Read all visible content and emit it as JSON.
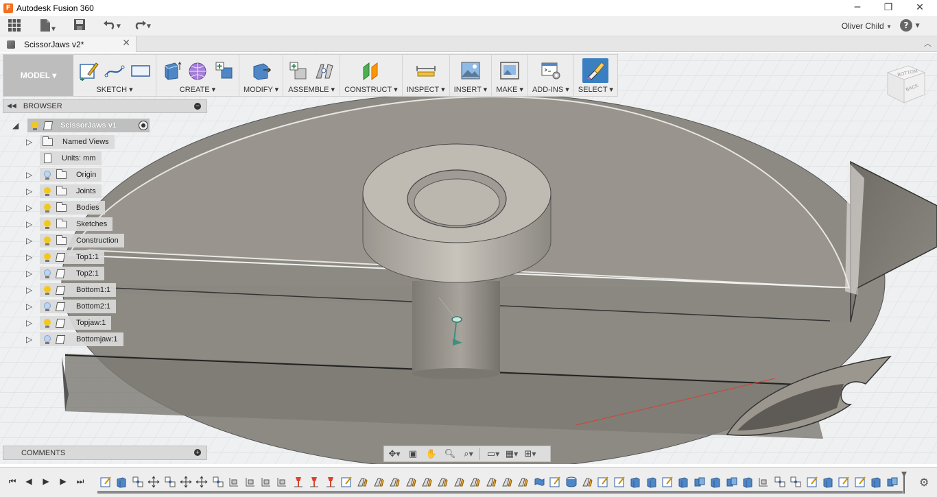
{
  "window": {
    "title": "Autodesk Fusion 360",
    "logo_letter": "F",
    "minimize_glyph": "─",
    "restore_glyph": "❐",
    "close_glyph": "✕"
  },
  "qat": {
    "user_name": "Oliver Child",
    "help_glyph": "?",
    "grid_icon": "app-grid-icon",
    "file_icon": "file-icon",
    "save_icon": "save-icon",
    "undo_icon": "undo-icon",
    "redo_icon": "redo-icon"
  },
  "doc_tab": {
    "name": "ScissorJaws v2*",
    "close_glyph": "✕"
  },
  "workspace": {
    "label": "MODEL ▾"
  },
  "toolbar": {
    "groups": [
      {
        "label": "SKETCH ▾",
        "icons": [
          "create-sketch-icon",
          "spline-icon",
          "rectangle-icon"
        ]
      },
      {
        "label": "CREATE ▾",
        "icons": [
          "extrude-icon",
          "form-icon",
          "new-component-icon"
        ]
      },
      {
        "label": "MODIFY ▾",
        "icons": [
          "press-pull-icon"
        ]
      },
      {
        "label": "ASSEMBLE ▾",
        "icons": [
          "new-component-icon",
          "joint-icon"
        ]
      },
      {
        "label": "CONSTRUCT ▾",
        "icons": [
          "offset-plane-icon"
        ]
      },
      {
        "label": "INSPECT ▾",
        "icons": [
          "measure-icon"
        ]
      },
      {
        "label": "INSERT ▾",
        "icons": [
          "insert-image-icon"
        ]
      },
      {
        "label": "MAKE ▾",
        "icons": [
          "3d-print-icon"
        ]
      },
      {
        "label": "ADD-INS ▾",
        "icons": [
          "scripts-icon"
        ]
      },
      {
        "label": "SELECT ▾",
        "icons": [
          "select-brush-icon"
        ]
      }
    ]
  },
  "browser": {
    "title": "BROWSER",
    "root": {
      "label": "ScissorJaws v1"
    },
    "items": [
      {
        "label": "Named Views",
        "type": "folder",
        "bulb": "none"
      },
      {
        "label": "Units: mm",
        "type": "doc",
        "bulb": "none"
      },
      {
        "label": "Origin",
        "type": "folder",
        "bulb": "off"
      },
      {
        "label": "Joints",
        "type": "folder",
        "bulb": "on"
      },
      {
        "label": "Bodies",
        "type": "folder",
        "bulb": "on"
      },
      {
        "label": "Sketches",
        "type": "folder",
        "bulb": "on"
      },
      {
        "label": "Construction",
        "type": "folder",
        "bulb": "on"
      },
      {
        "label": "Top1:1",
        "type": "component",
        "bulb": "on"
      },
      {
        "label": "Top2:1",
        "type": "component",
        "bulb": "off"
      },
      {
        "label": "Bottom1:1",
        "type": "component",
        "bulb": "on"
      },
      {
        "label": "Bottom2:1",
        "type": "component",
        "bulb": "off"
      },
      {
        "label": "Topjaw:1",
        "type": "component",
        "bulb": "on"
      },
      {
        "label": "Bottomjaw:1",
        "type": "component",
        "bulb": "off"
      }
    ]
  },
  "comments": {
    "title": "COMMENTS"
  },
  "viewcube": {
    "face_top": "BOTTOM",
    "face_side": "BACK"
  },
  "navbar": {
    "items": [
      "orbit-icon",
      "look-at-icon",
      "pan-icon",
      "zoom-icon",
      "fit-icon",
      "display-settings-icon",
      "grid-settings-icon",
      "viewports-icon"
    ]
  },
  "timeline": {
    "controls": [
      "go-to-start-icon",
      "step-back-icon",
      "play-icon",
      "step-forward-icon",
      "go-to-end-icon"
    ],
    "feature_count": 50,
    "settings_icon": "gear-icon"
  },
  "colors": {
    "select_accent": "#3a7fc1",
    "model_gray": "#8f8c85",
    "timeline_red": "#e0412b"
  }
}
